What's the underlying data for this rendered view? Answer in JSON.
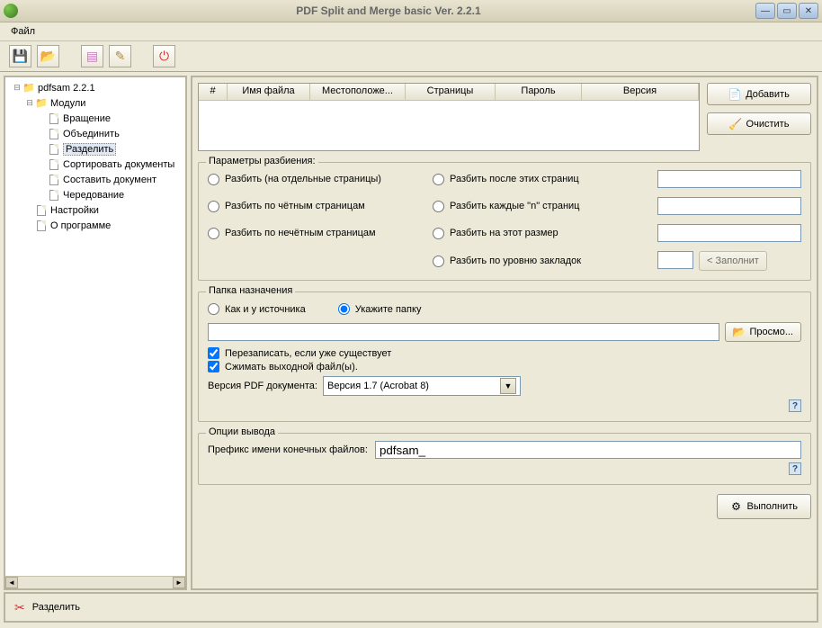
{
  "title": "PDF Split and Merge basic Ver. 2.2.1",
  "menu": {
    "file": "Файл"
  },
  "tree": {
    "root": "pdfsam 2.2.1",
    "modules": "Модули",
    "items": [
      "Вращение",
      "Объединить",
      "Разделить",
      "Сортировать документы",
      "Составить документ",
      "Чередование"
    ],
    "settings": "Настройки",
    "about": "О программе"
  },
  "grid_headers": [
    "#",
    "Имя файла",
    "Местоположе...",
    "Страницы",
    "Пароль",
    "Версия"
  ],
  "buttons": {
    "add": "Добавить",
    "clear": "Очистить",
    "browse": "Просмо...",
    "fill": "< Заполнит",
    "execute": "Выполнить"
  },
  "split": {
    "legend": "Параметры разбиения:",
    "o1": "Разбить (на отдельные страницы)",
    "o2": "Разбить по чётным страницам",
    "o3": "Разбить по нечётным страницам",
    "o4": "Разбить после этих страниц",
    "o5": "Разбить каждые \"n\" страниц",
    "o6": "Разбить на этот размер",
    "o7": "Разбить по уровню закладок"
  },
  "dest": {
    "legend": "Папка назначения",
    "same": "Как и у источника",
    "choose": "Укажите папку",
    "path": "",
    "overwrite": "Перезаписать, если уже существует",
    "compress": "Сжимать выходной файл(ы).",
    "verlabel": "Версия PDF документа:",
    "version": "Версия 1.7 (Acrobat 8)"
  },
  "out": {
    "legend": "Опции вывода",
    "prefix_label": "Префикс имени конечных файлов:",
    "prefix": "pdfsam_"
  },
  "statusbar": "Разделить"
}
